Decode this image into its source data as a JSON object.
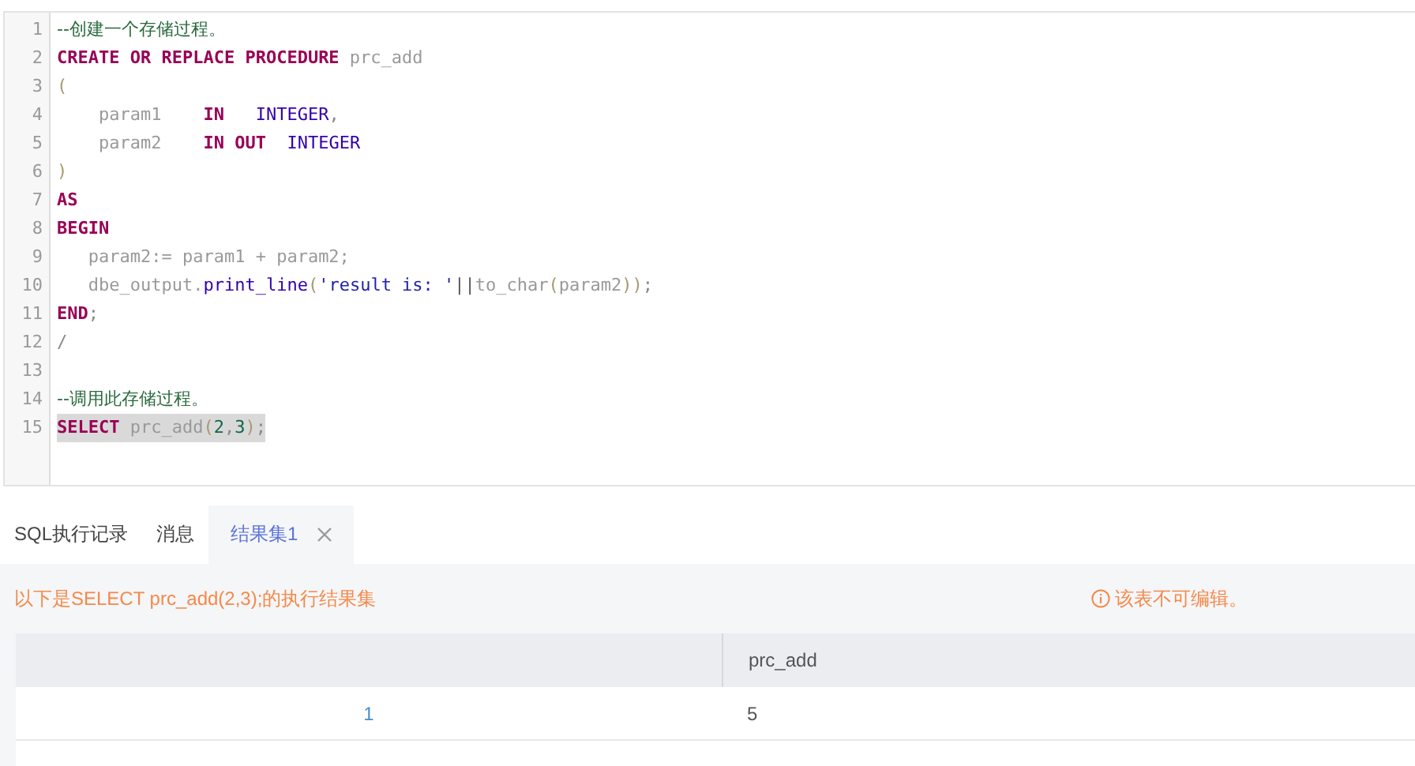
{
  "editor": {
    "lines": [
      {
        "number": "1",
        "highlighted": false,
        "tokens": [
          {
            "kind": "comment",
            "text": "--创建一个存储过程。"
          }
        ]
      },
      {
        "number": "2",
        "highlighted": false,
        "tokens": [
          {
            "kind": "keyword",
            "text": "CREATE OR REPLACE PROCEDURE"
          },
          {
            "kind": "ident",
            "text": " prc_add"
          }
        ]
      },
      {
        "number": "3",
        "highlighted": false,
        "tokens": [
          {
            "kind": "bracket",
            "text": "("
          }
        ]
      },
      {
        "number": "4",
        "highlighted": false,
        "tokens": [
          {
            "kind": "ident",
            "text": "    param1    "
          },
          {
            "kind": "keyword",
            "text": "IN"
          },
          {
            "kind": "type",
            "text": "   INTEGER"
          },
          {
            "kind": "punct",
            "text": ","
          }
        ]
      },
      {
        "number": "5",
        "highlighted": false,
        "tokens": [
          {
            "kind": "ident",
            "text": "    param2    "
          },
          {
            "kind": "keyword",
            "text": "IN OUT"
          },
          {
            "kind": "type",
            "text": "  INTEGER"
          }
        ]
      },
      {
        "number": "6",
        "highlighted": false,
        "tokens": [
          {
            "kind": "bracket",
            "text": ")"
          }
        ]
      },
      {
        "number": "7",
        "highlighted": false,
        "tokens": [
          {
            "kind": "keyword",
            "text": "AS"
          }
        ]
      },
      {
        "number": "8",
        "highlighted": false,
        "tokens": [
          {
            "kind": "keyword",
            "text": "BEGIN"
          }
        ]
      },
      {
        "number": "9",
        "highlighted": false,
        "tokens": [
          {
            "kind": "ident",
            "text": "   param2:= param1 + param2;"
          }
        ]
      },
      {
        "number": "10",
        "highlighted": false,
        "tokens": [
          {
            "kind": "ident",
            "text": "   dbe_output."
          },
          {
            "kind": "func",
            "text": "print_line"
          },
          {
            "kind": "bracket",
            "text": "("
          },
          {
            "kind": "string",
            "text": "'result is: '"
          },
          {
            "kind": "operator",
            "text": "||"
          },
          {
            "kind": "ident",
            "text": "to_char"
          },
          {
            "kind": "bracket",
            "text": "("
          },
          {
            "kind": "ident",
            "text": "param2"
          },
          {
            "kind": "bracket",
            "text": "))"
          },
          {
            "kind": "punct",
            "text": ";"
          }
        ]
      },
      {
        "number": "11",
        "highlighted": false,
        "tokens": [
          {
            "kind": "keyword",
            "text": "END"
          },
          {
            "kind": "punct",
            "text": ";"
          }
        ]
      },
      {
        "number": "12",
        "highlighted": false,
        "tokens": [
          {
            "kind": "punct",
            "text": "/"
          }
        ]
      },
      {
        "number": "13"
      },
      {
        "number": "14",
        "highlighted": false,
        "tokens": [
          {
            "kind": "comment",
            "text": "--调用此存储过程。"
          }
        ]
      },
      {
        "number": "15",
        "highlighted": true,
        "tokens": [
          {
            "kind": "keyword",
            "text": "SELECT"
          },
          {
            "kind": "ident",
            "text": " prc_add"
          },
          {
            "kind": "bracket",
            "text": "("
          },
          {
            "kind": "number",
            "text": "2"
          },
          {
            "kind": "punct",
            "text": ","
          },
          {
            "kind": "number",
            "text": "3"
          },
          {
            "kind": "bracket",
            "text": ")"
          },
          {
            "kind": "punct",
            "text": ";"
          }
        ]
      }
    ]
  },
  "tabs": [
    {
      "label": "SQL执行记录",
      "selected": false,
      "closable": false
    },
    {
      "label": "消息",
      "selected": false,
      "closable": false
    },
    {
      "label": "结果集1",
      "selected": true,
      "closable": true
    }
  ],
  "result": {
    "caption": "以下是SELECT prc_add(2,3);的执行结果集",
    "notice": "该表不可编辑。",
    "table": {
      "columns": [
        "",
        "prc_add"
      ],
      "rows": [
        [
          "1",
          "5"
        ]
      ]
    }
  }
}
